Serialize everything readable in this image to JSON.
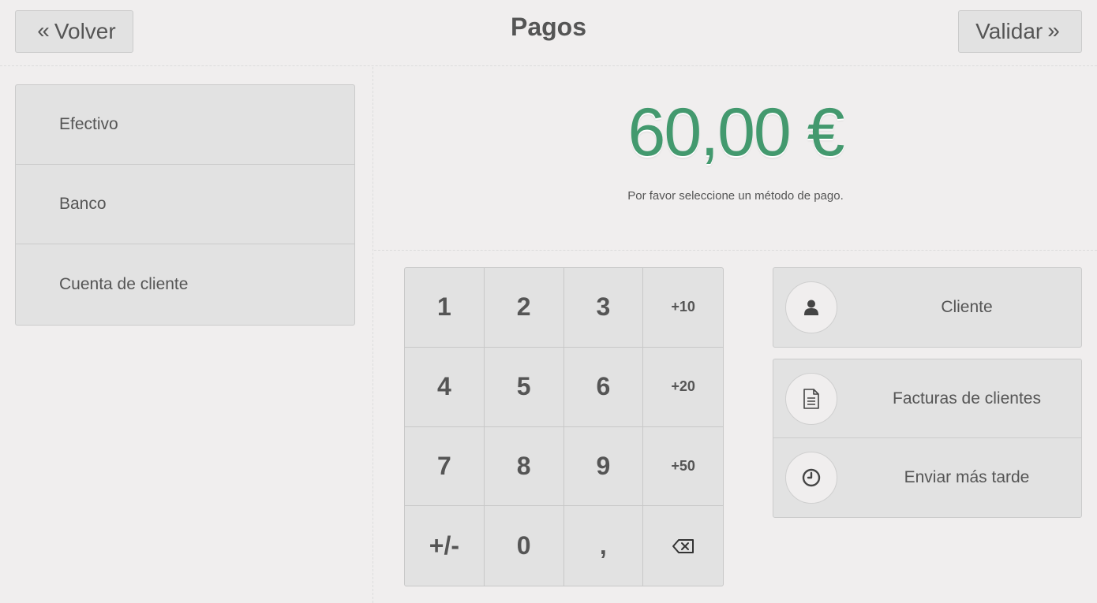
{
  "header": {
    "back_label": "Volver",
    "title": "Pagos",
    "validate_label": "Validar"
  },
  "payment_methods": [
    {
      "label": "Efectivo"
    },
    {
      "label": "Banco"
    },
    {
      "label": "Cuenta de cliente"
    }
  ],
  "summary": {
    "total": "60,00 €",
    "hint": "Por favor seleccione un método de pago."
  },
  "numpad": {
    "keys": [
      "1",
      "2",
      "3",
      "+10",
      "4",
      "5",
      "6",
      "+20",
      "7",
      "8",
      "9",
      "+50",
      "+/-",
      "0",
      ",",
      "backspace-icon"
    ]
  },
  "actions": {
    "customer_label": "Cliente",
    "invoice_label": "Facturas de clientes",
    "send_later_label": "Enviar más tarde",
    "customer_icon": "user-icon",
    "invoice_icon": "document-icon",
    "send_later_icon": "clock-icon"
  },
  "colors": {
    "accent": "#43996e",
    "background": "#f0eeee",
    "button": "#e2e2e2",
    "text": "#555555"
  }
}
